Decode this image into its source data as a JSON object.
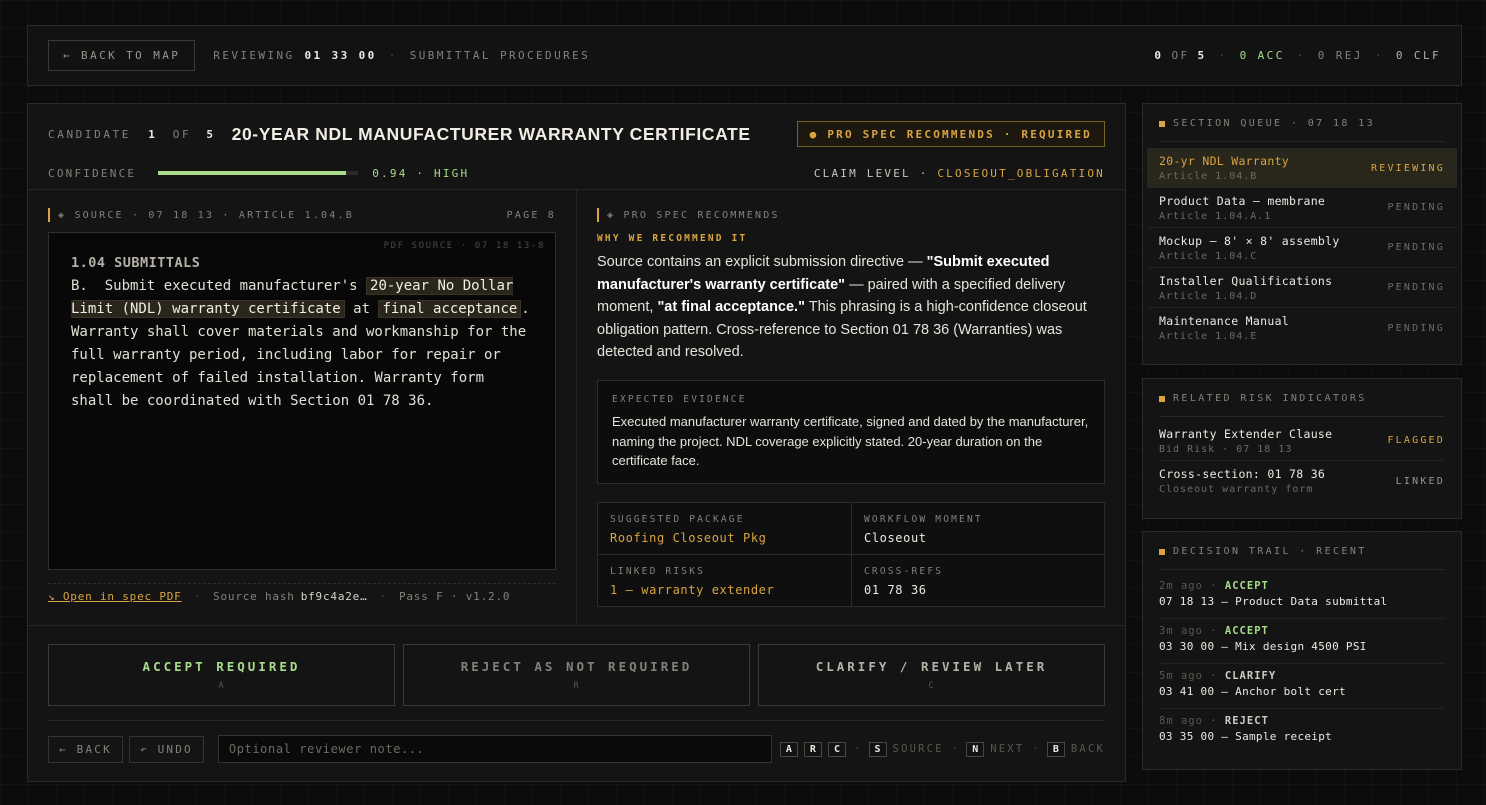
{
  "topbar": {
    "back_label": "← BACK TO MAP",
    "reviewing_label": "REVIEWING",
    "section_code": "01 33 00",
    "section_name": "SUBMITTAL PROCEDURES",
    "progress_done": "0",
    "progress_of": "OF",
    "progress_total": "5",
    "acc": "0 ACC",
    "rej": "0 REJ",
    "clf": "0 CLF"
  },
  "candidate": {
    "label": "CANDIDATE",
    "index": "1",
    "of": "OF",
    "total": "5",
    "title": "20-YEAR NDL MANUFACTURER WARRANTY CERTIFICATE",
    "badge": "● PRO SPEC RECOMMENDS · REQUIRED",
    "confidence_label": "CONFIDENCE",
    "confidence_value": 0.94,
    "confidence_text": "0.94 · HIGH",
    "claim_label": "CLAIM LEVEL ·",
    "claim_value": "CLOSEOUT_OBLIGATION"
  },
  "source": {
    "header": "◈ SOURCE · 07 18 13 · ARTICLE 1.04.B",
    "page": "PAGE 8",
    "pdf_tag": "PDF SOURCE · 07 18 13-8",
    "heading": "1.04 SUBMITTALS",
    "para_prefix": "B.  Submit executed manufacturer's ",
    "hl1": "20-year No Dollar Limit (NDL) warranty certificate",
    "para_mid": " at ",
    "hl2": "final acceptance",
    "para_suffix": ". Warranty shall cover materials and workmanship for the full warranty period, including labor for repair or replacement of failed installation. Warranty form shall be coordinated with Section 01 78 36.",
    "open_link": "↘ Open in spec PDF",
    "hash_label": "Source hash",
    "hash_value": "bf9c4a2e…",
    "pass": "Pass F · v1.2.0"
  },
  "recommendation": {
    "header": "◈ PRO SPEC RECOMMENDS",
    "why_label": "WHY WE RECOMMEND IT",
    "text_1": "Source contains an explicit submission directive — ",
    "bold_1": "\"Submit executed manufacturer's warranty certificate\"",
    "text_2": " — paired with a specified delivery moment, ",
    "bold_2": "\"at final acceptance.\"",
    "text_3": " This phrasing is a high-confidence closeout obligation pattern. Cross-reference to Section 01 78 36 (Warranties) was detected and resolved.",
    "evidence_label": "EXPECTED EVIDENCE",
    "evidence_text": "Executed manufacturer warranty certificate, signed and dated by the manufacturer, naming the project. NDL coverage explicitly stated. 20-year duration on the certificate face.",
    "package_label": "SUGGESTED PACKAGE",
    "package_value": "Roofing Closeout Pkg",
    "workflow_label": "WORKFLOW MOMENT",
    "workflow_value": "Closeout",
    "risks_label": "LINKED RISKS",
    "risks_value": "1 — warranty extender",
    "xrefs_label": "CROSS-REFS",
    "xrefs_value": "01 78 36"
  },
  "actions": {
    "accept": "ACCEPT REQUIRED",
    "accept_key": "A",
    "reject": "REJECT AS NOT REQUIRED",
    "reject_key": "R",
    "clarify": "CLARIFY / REVIEW LATER",
    "clarify_key": "C",
    "back": "← BACK",
    "undo": "↶ UNDO",
    "note_placeholder": "Optional reviewer note...",
    "keys": {
      "a": "A",
      "r": "R",
      "c": "C",
      "s": "S",
      "s_label": "SOURCE",
      "n": "N",
      "n_label": "NEXT",
      "b": "B",
      "b_label": "BACK"
    }
  },
  "queue": {
    "header": "SECTION QUEUE · 07 18 13",
    "items": [
      {
        "name": "20-yr NDL Warranty",
        "sub": "Article 1.04.B",
        "status": "REVIEWING"
      },
      {
        "name": "Product Data — membrane",
        "sub": "Article 1.04.A.1",
        "status": "PENDING"
      },
      {
        "name": "Mockup — 8' × 8' assembly",
        "sub": "Article 1.04.C",
        "status": "PENDING"
      },
      {
        "name": "Installer Qualifications",
        "sub": "Article 1.04.D",
        "status": "PENDING"
      },
      {
        "name": "Maintenance Manual",
        "sub": "Article 1.04.E",
        "status": "PENDING"
      }
    ]
  },
  "risks": {
    "header": "RELATED RISK INDICATORS",
    "items": [
      {
        "name": "Warranty Extender Clause",
        "sub": "Bid Risk · 07 18 13",
        "status": "FLAGGED"
      },
      {
        "name": "Cross-section: 01 78 36",
        "sub": "Closeout warranty form",
        "status": "LINKED"
      }
    ]
  },
  "trail": {
    "header": "DECISION TRAIL · RECENT",
    "items": [
      {
        "time": "2m ago",
        "action": "ACCEPT",
        "desc": "07 18 13 — Product Data submittal"
      },
      {
        "time": "3m ago",
        "action": "ACCEPT",
        "desc": "03 30 00 — Mix design 4500 PSI"
      },
      {
        "time": "5m ago",
        "action": "CLARIFY",
        "desc": "03 41 00 — Anchor bolt cert"
      },
      {
        "time": "8m ago",
        "action": "REJECT",
        "desc": "03 35 00 — Sample receipt"
      }
    ]
  },
  "colors": {
    "accent_gold": "#d9a441",
    "accent_green": "#a8dc8a",
    "background": "#0c0c0c"
  }
}
